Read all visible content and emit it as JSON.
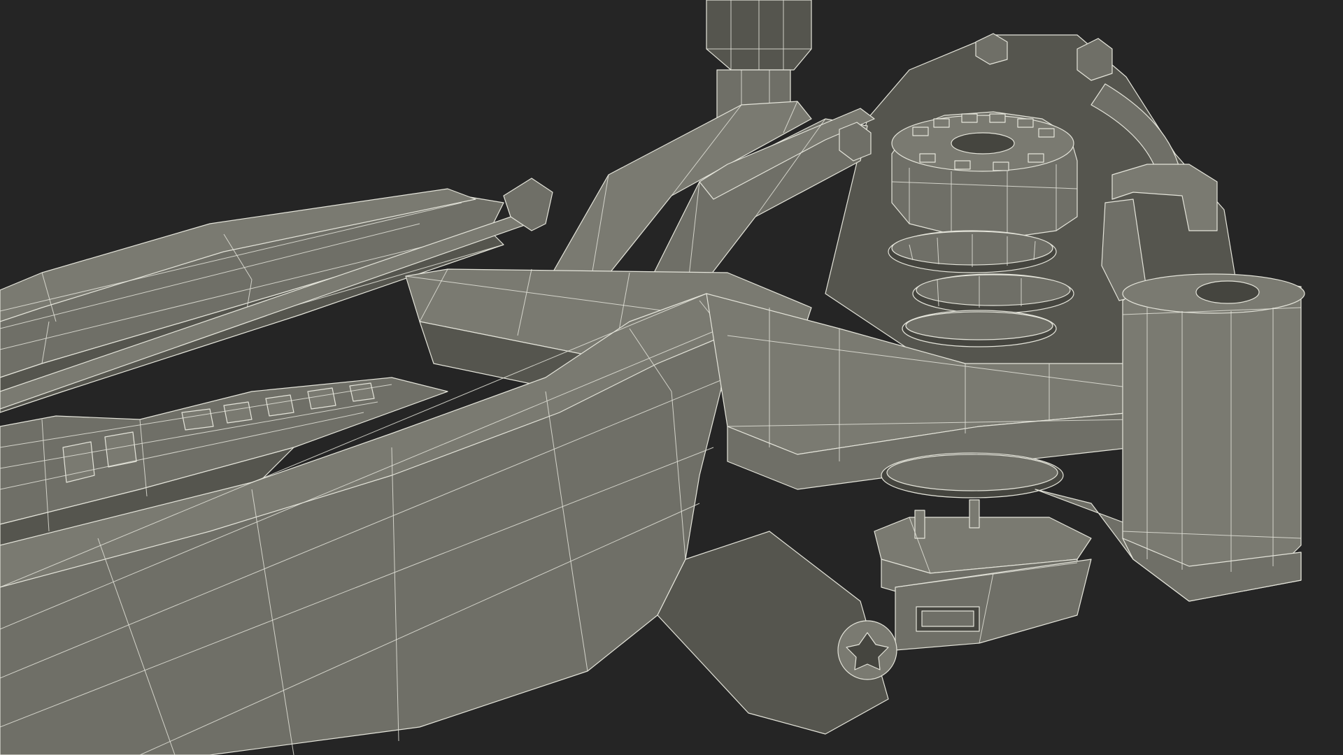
{
  "scene": {
    "colors": {
      "background": "#252525",
      "surface": "#6f6f67",
      "surface_light": "#7a7a71",
      "surface_dark": "#55554e",
      "surface_darker": "#45453f",
      "wire": "#e4e4da"
    }
  }
}
